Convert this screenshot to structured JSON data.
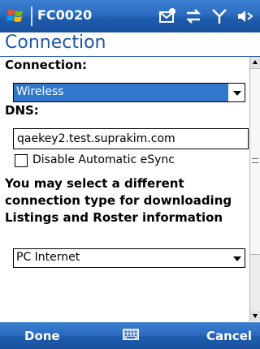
{
  "titlebar": {
    "app_name": "FC0020"
  },
  "page": {
    "title": "Connection"
  },
  "form": {
    "connection_label": "Connection:",
    "connection_value": "Wireless",
    "dns_label": "DNS:",
    "dns_value": "qaekey2.test.suprakim.com",
    "disable_esync_label": "Disable Automatic eSync",
    "message": "You may select a different connection type for downloading Listings and Roster information",
    "download_connection_value": "PC Internet"
  },
  "softkeys": {
    "left": "Done",
    "right": "Cancel"
  },
  "colors": {
    "bar_blue": "#2c6cc0",
    "heading_blue": "#1f57a4",
    "selection_blue": "#3177cc"
  }
}
